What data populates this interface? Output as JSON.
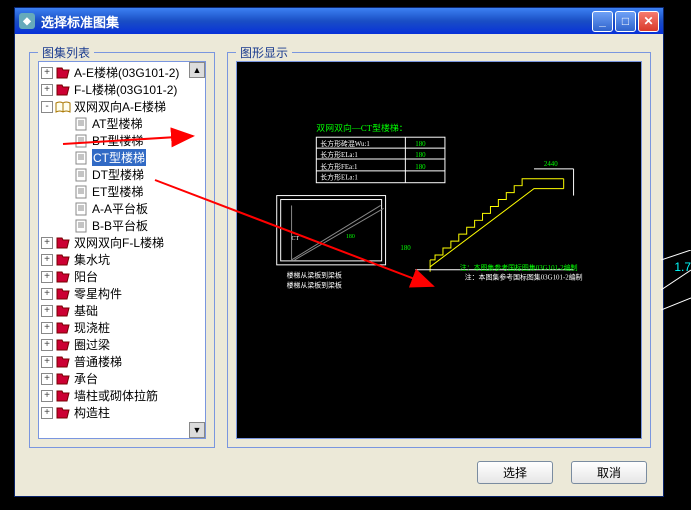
{
  "dialog": {
    "title": "选择标准图集",
    "buttons": {
      "select": "选择",
      "cancel": "取消"
    }
  },
  "groupbox": {
    "tree_title": "图集列表",
    "preview_title": "图形显示"
  },
  "tree": {
    "nodes": [
      {
        "level": 0,
        "expander": "+",
        "icon": "book-red",
        "label": "A-E楼梯(03G101-2)"
      },
      {
        "level": 0,
        "expander": "+",
        "icon": "book-red",
        "label": "F-L楼梯(03G101-2)"
      },
      {
        "level": 0,
        "expander": "-",
        "icon": "book-open",
        "label": "双网双向A-E楼梯"
      },
      {
        "level": 1,
        "expander": "",
        "icon": "page",
        "label": "AT型楼梯"
      },
      {
        "level": 1,
        "expander": "",
        "icon": "page",
        "label": "BT型楼梯"
      },
      {
        "level": 1,
        "expander": "",
        "icon": "page",
        "label": "CT型楼梯",
        "selected": true
      },
      {
        "level": 1,
        "expander": "",
        "icon": "page",
        "label": "DT型楼梯"
      },
      {
        "level": 1,
        "expander": "",
        "icon": "page",
        "label": "ET型楼梯"
      },
      {
        "level": 1,
        "expander": "",
        "icon": "page",
        "label": "A-A平台板"
      },
      {
        "level": 1,
        "expander": "",
        "icon": "page",
        "label": "B-B平台板"
      },
      {
        "level": 0,
        "expander": "+",
        "icon": "book-red",
        "label": "双网双向F-L楼梯"
      },
      {
        "level": 0,
        "expander": "+",
        "icon": "book-red",
        "label": "集水坑"
      },
      {
        "level": 0,
        "expander": "+",
        "icon": "book-red",
        "label": "阳台"
      },
      {
        "level": 0,
        "expander": "+",
        "icon": "book-red",
        "label": "零星构件"
      },
      {
        "level": 0,
        "expander": "+",
        "icon": "book-red",
        "label": "基础"
      },
      {
        "level": 0,
        "expander": "+",
        "icon": "book-red",
        "label": "现浇桩"
      },
      {
        "level": 0,
        "expander": "+",
        "icon": "book-red",
        "label": "圈过梁"
      },
      {
        "level": 0,
        "expander": "+",
        "icon": "book-red",
        "label": "普通楼梯"
      },
      {
        "level": 0,
        "expander": "+",
        "icon": "book-red",
        "label": "承台"
      },
      {
        "level": 0,
        "expander": "+",
        "icon": "book-red",
        "label": "墙柱或砌体拉筋"
      },
      {
        "level": 0,
        "expander": "+",
        "icon": "book-red",
        "label": "构造柱"
      }
    ]
  },
  "preview": {
    "heading": "双网双向—CT型楼梯：",
    "table": [
      "长方形砖混Wu:1",
      "长方形ELa:1",
      "长方形FEa:1",
      "长方形ELa:1"
    ],
    "left_label": "楼梯从梁板到梁板",
    "bottom_label": "楼梯从梁板到梁板",
    "note": "注：本图集参考国标图集03G101-2编制",
    "dims": [
      "180",
      "180",
      "180"
    ]
  },
  "bg": {
    "dim": "1.7"
  }
}
